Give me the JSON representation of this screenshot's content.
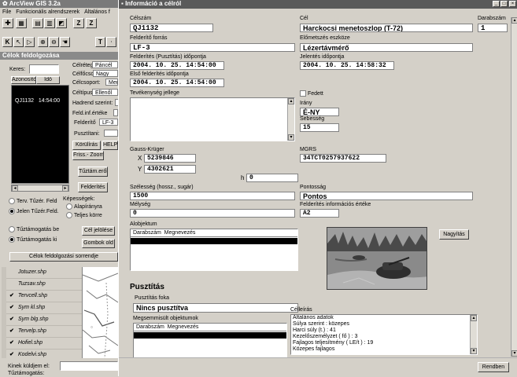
{
  "app": {
    "title": "ArcView GIS 3.2a",
    "menu": [
      "File",
      "Funkcionális alrendszerek",
      "Általános f"
    ]
  },
  "left_panel": {
    "title": "Célok feldolgozása",
    "search_label": "Keres:",
    "list_headers": [
      "Azonosító",
      "Idő"
    ],
    "list_rows": [
      {
        "id": "QJ1132",
        "time": "14:54:00"
      }
    ],
    "labels": [
      "Célréteg:",
      "Célfőcsop:",
      "Célcsoport:",
      "Céltípus:",
      "Hadrend szerint:",
      "Feld.inf.értéke",
      "Felderítő",
      "Pusztítani:"
    ],
    "values": [
      "Páncél",
      "Nagy",
      "Merv",
      "Ellenől",
      "",
      "",
      "LF-3",
      ""
    ],
    "buttons": {
      "korulirás": "Körülírás",
      "help": "HELP",
      "frissit": "Friss.- Zoom",
      "tuztam": "Tűztám.erők",
      "felderites": "Felderítés",
      "cel_jelolese": "Cél jelölése",
      "gombok": "Gombok old",
      "sorrend": "Célok feldolgozási sorrendje"
    },
    "radio_group1": [
      "Terv. Tűzér. Feld",
      "Jelen Tűzér.Feld."
    ],
    "kepessegek_title": "Képességek:",
    "kepessegek": [
      "Alapírányra",
      "Teljes körre"
    ],
    "radio_group2": [
      "Tűztámogatás be",
      "Tűztámogatás ki"
    ],
    "layers": [
      "Jotuzer.shp",
      "Tuzsav.shp",
      "Tervcell.shp",
      "Sym kl.shp",
      "Sym blg.shp",
      "Tervelp.shp",
      "Hofiel.shp",
      "Kodelvi.shp"
    ],
    "layers_checked": [
      false,
      false,
      true,
      true,
      true,
      true,
      true,
      true
    ],
    "bottom_label": "Kinek küldjem el:",
    "bottom_label2": "Tűztámogatás:"
  },
  "dialog": {
    "title": "Információ a célról",
    "celszam_label": "Célszám",
    "celszam": "QJ1132",
    "cel_label": "Cél",
    "cel": "Harckocsi menetoszlop (T-72)",
    "darabszam_label": "Darabszám",
    "darabszam": "1",
    "felderito_forras_label": "Felderítő forrás",
    "felderito_forras": "LF-3",
    "eszkoz_label": "Előmetszés eszköze",
    "eszkoz": "Lézertávmérő",
    "idopont_label": "Felderítés (Pusztítás) időpontja",
    "idopont": "2004. 10. 25. 14:54:00",
    "jelentes_label": "Jelentés időpontja",
    "jelentes": "2004. 10. 25. 14:58:32",
    "elso_label": "Első felderítés időpontja",
    "elso": "2004. 10. 25. 14:54:00",
    "tevekenyseg_label": "Tevékenység jellege",
    "fedett_label": "Fedett",
    "irany_label": "Irány",
    "irany": "É-NY",
    "sebesseg_label": "Sebesség",
    "sebesseg": "15",
    "gauss_label": "Gauss-Krüger",
    "x_label": "X",
    "x": "5239846",
    "y_label": "Y",
    "y": "4302621",
    "h_label": "h",
    "h": "0",
    "mgrs_label": "MGRS",
    "mgrs": "34TCT0257937622",
    "szelesseg_label": "Szélesség (hossz., sugár)",
    "szelesseg": "1500",
    "pontossag_label": "Pontosság",
    "pontossag": "Pontos",
    "melyseg_label": "Mélység",
    "melyseg": "0",
    "ertek_label": "Felderítés információs értéke",
    "ertek": "A2",
    "alobjektum_label": "Alobjektum",
    "alobjektum_header": "Darabszám  Megnevezés",
    "nagyitas": "Nagyítás",
    "pusztitas_title": "Pusztítás",
    "pusztitas_foka_label": "Pusztítás foka",
    "pusztitas_foka": "Nincs pusztítva",
    "megsemmisult_label": "Megsemmisült objektumok",
    "megsemmisult_header": "Darabszám  Megnevezés",
    "celleiras_label": "Célleírás",
    "celleiras": [
      "Általános adatok",
      "Súlya szerint : közepes",
      "Harci súly (t.) : 41",
      "Kezelőszemélyzet ( fő ) : 3",
      "Fajlagos teljesítmény ( LE/t ) : 19",
      "Közepes fajlagos"
    ],
    "rendben": "Rendben"
  },
  "map": {
    "road_color": "#9a9a9a"
  }
}
